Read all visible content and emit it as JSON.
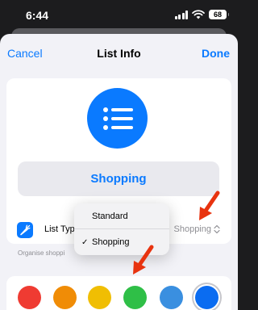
{
  "status_bar": {
    "time": "6:44",
    "battery": "68"
  },
  "nav": {
    "cancel": "Cancel",
    "title": "List Info",
    "done": "Done"
  },
  "header": {
    "icon": "list-bullet-icon",
    "list_name": "Shopping"
  },
  "list_type": {
    "icon": "carrot-icon",
    "label": "List Type",
    "value": "Shopping"
  },
  "footnote": "Organise shoppi",
  "menu": {
    "items": [
      {
        "label": "Standard",
        "checked": false
      },
      {
        "label": "Shopping",
        "checked": true
      }
    ],
    "check_mark": "✓"
  },
  "colors": {
    "accent": "#0a7aff",
    "annotation_arrow": "#e8330f",
    "swatches": [
      "#ef3b32",
      "#f08c06",
      "#f0be03",
      "#2fbf47",
      "#3a8fe0",
      "#0a6cf1"
    ],
    "selected_swatch": 5
  }
}
